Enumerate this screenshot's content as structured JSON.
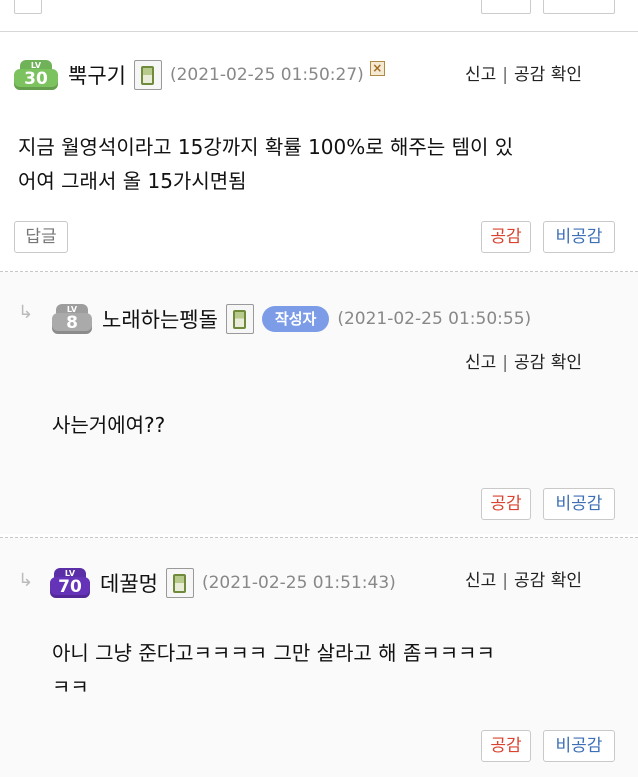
{
  "comments": [
    {
      "level": "30",
      "nickname": "뿍구기",
      "date": "(2021-02-25 01:50:27)",
      "report": "신고",
      "check_like": "공감 확인",
      "text_line1": "지금 월영석이라고 15강까지 확률 100%로 해주는 템이 있",
      "text_line2": "어여 그래서 올 15가시면됨",
      "reply_label": "답글",
      "like_label": "공감",
      "unlike_label": "비공감"
    },
    {
      "level": "8",
      "nickname": "노래하는펭돌",
      "writer_badge": "작성자",
      "date": "(2021-02-25 01:50:55)",
      "report": "신고",
      "check_like": "공감 확인",
      "text_line1": "사는거에여??",
      "like_label": "공감",
      "unlike_label": "비공감"
    },
    {
      "level": "70",
      "nickname": "데꿀멍",
      "date": "(2021-02-25 01:51:43)",
      "report": "신고",
      "check_like": "공감 확인",
      "text_line1": "아니 그냥 준다고ㅋㅋㅋㅋ 그만 살라고 해 좀ㅋㅋㅋㅋ",
      "text_line2": "ㅋㅋ",
      "like_label": "공감",
      "unlike_label": "비공감"
    }
  ],
  "separator": "|",
  "colors": {
    "like": "#d9432f",
    "unlike": "#3c6fb6",
    "writer_badge": "#7c9ce8",
    "date": "#888888"
  },
  "icons": [
    "level-badge-icon",
    "mobile-phone-icon",
    "block-x-icon",
    "reply-arrow-icon"
  ]
}
